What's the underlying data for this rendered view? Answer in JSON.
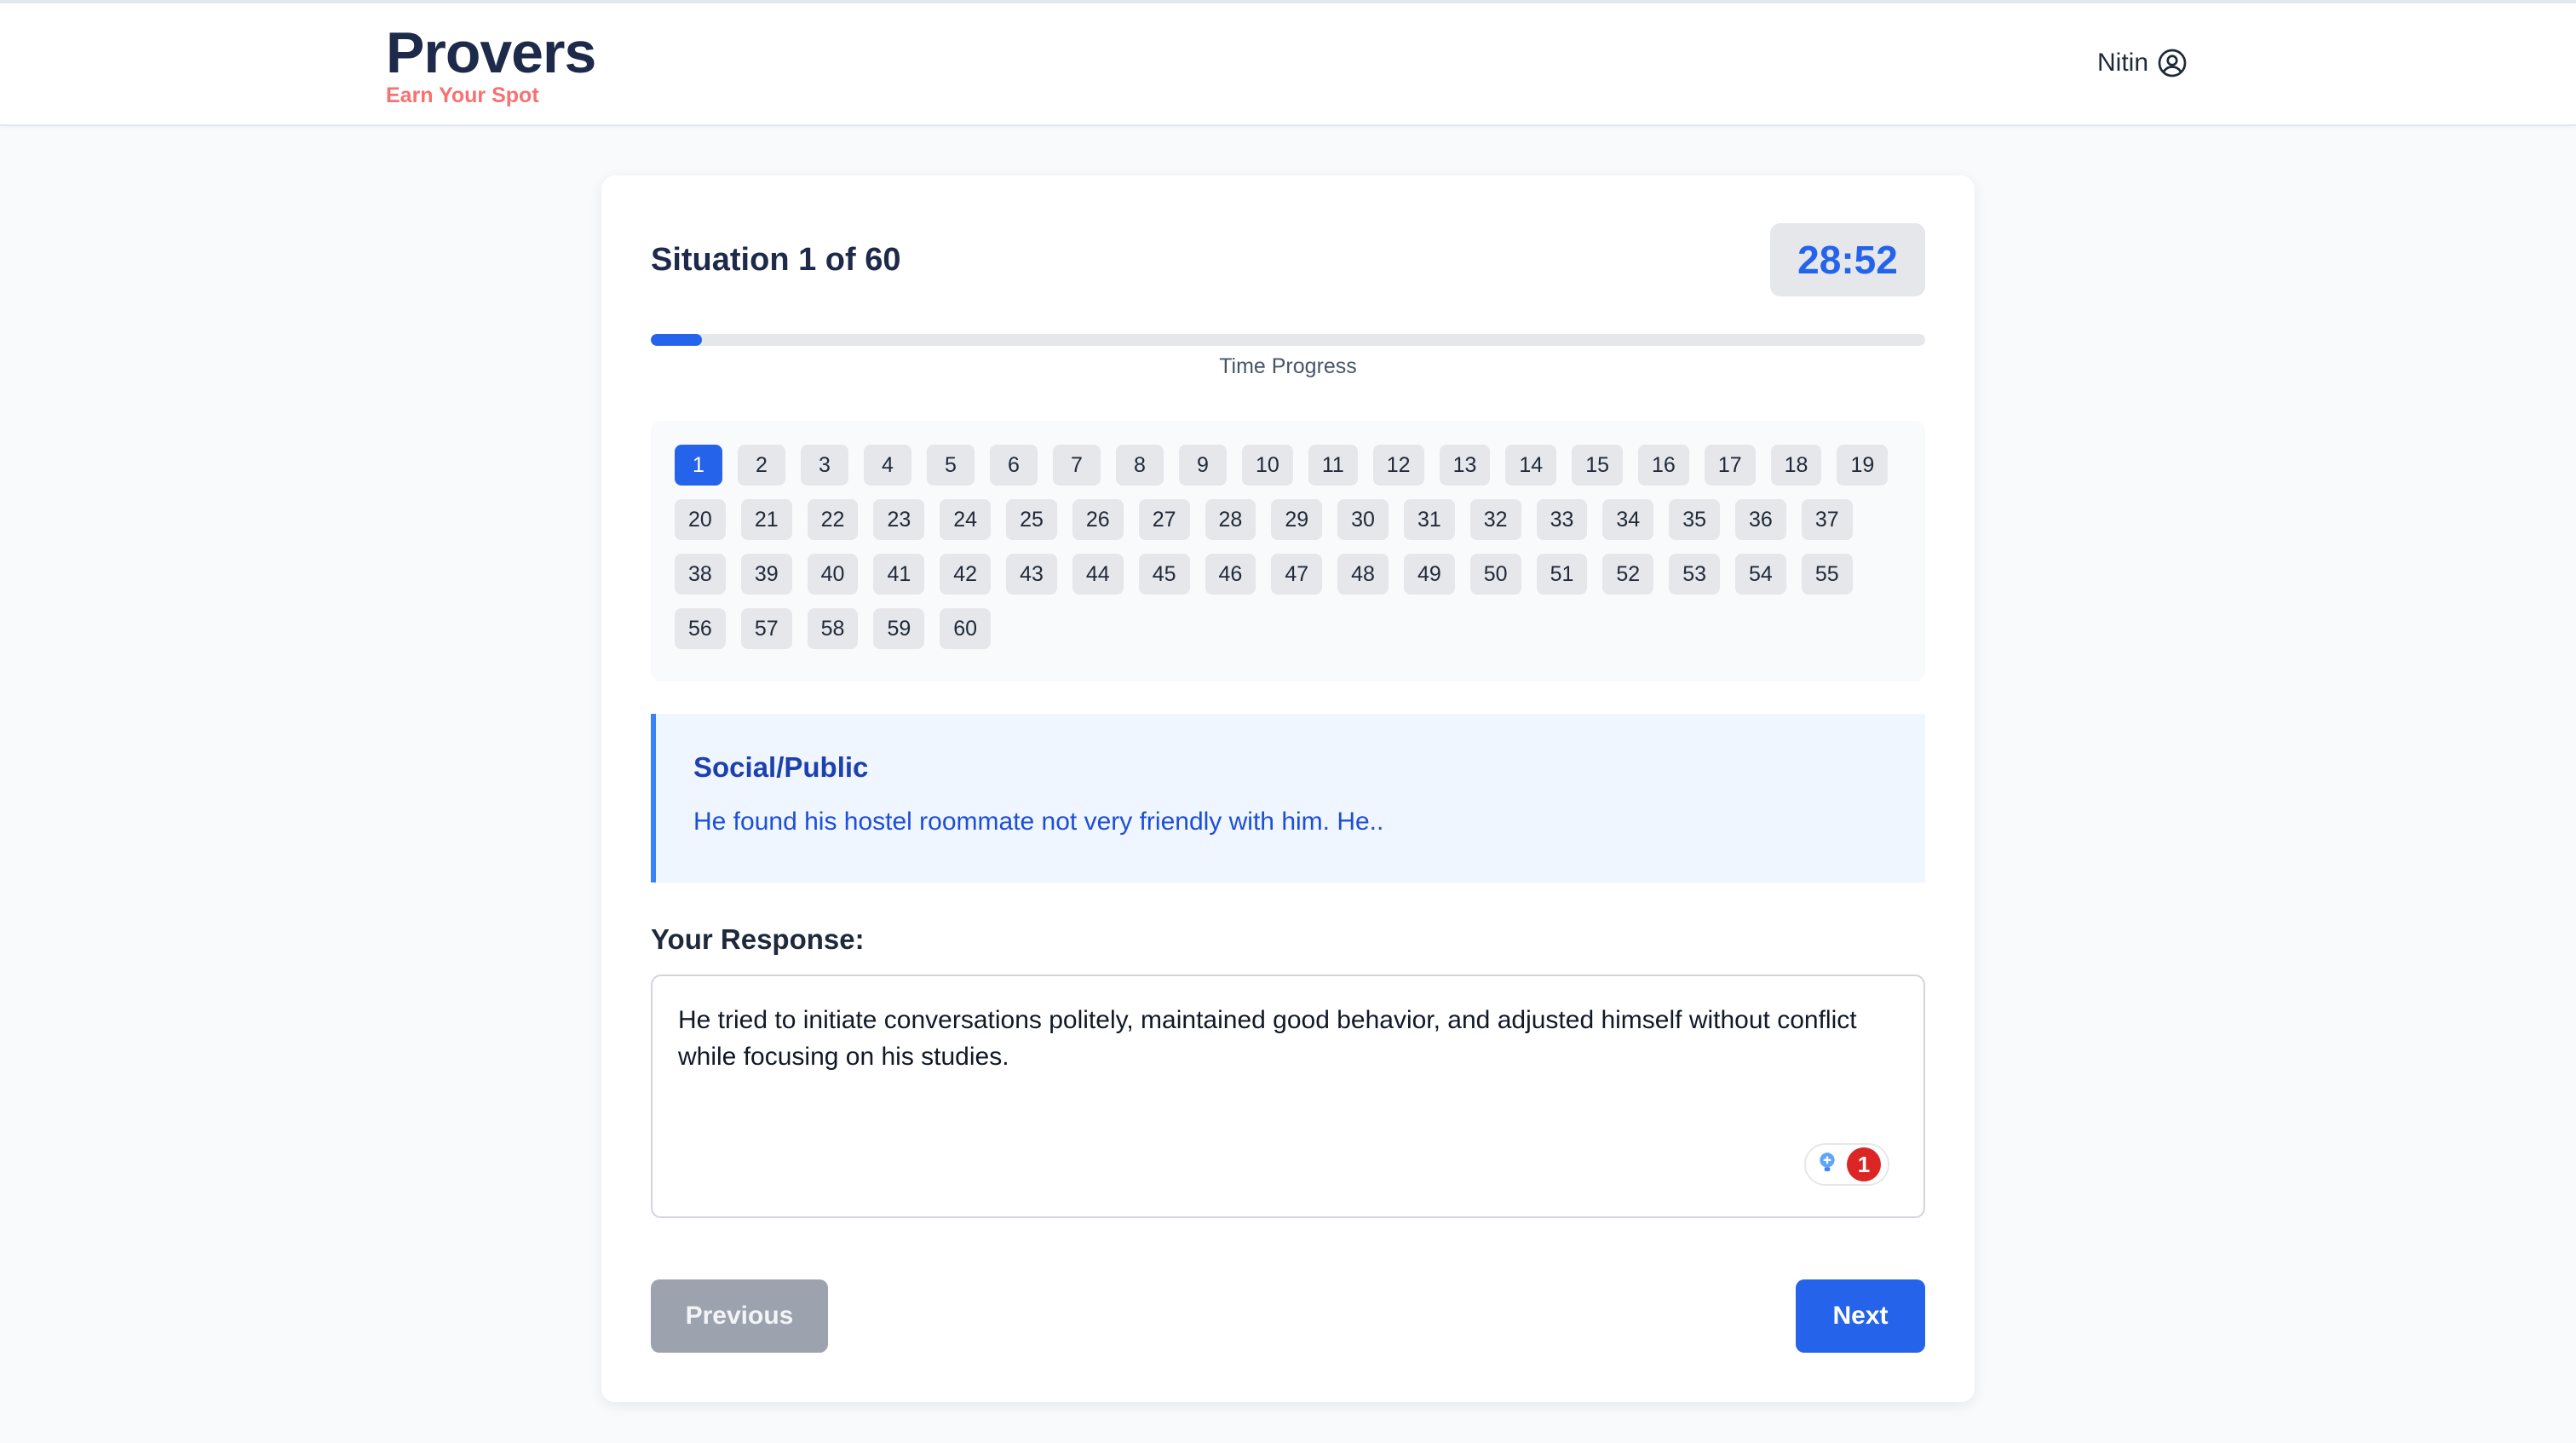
{
  "header": {
    "brand_name": "Provers",
    "brand_tagline": "Earn Your Spot",
    "user_name": "Nitin"
  },
  "quiz": {
    "title": "Situation 1 of 60",
    "timer": "28:52",
    "progress_label": "Time Progress",
    "progress_fraction": 0.04,
    "current_question": 1,
    "questions": [
      "1",
      "2",
      "3",
      "4",
      "5",
      "6",
      "7",
      "8",
      "9",
      "10",
      "11",
      "12",
      "13",
      "14",
      "15",
      "16",
      "17",
      "18",
      "19",
      "20",
      "21",
      "22",
      "23",
      "24",
      "25",
      "26",
      "27",
      "28",
      "29",
      "30",
      "31",
      "32",
      "33",
      "34",
      "35",
      "36",
      "37",
      "38",
      "39",
      "40",
      "41",
      "42",
      "43",
      "44",
      "45",
      "46",
      "47",
      "48",
      "49",
      "50",
      "51",
      "52",
      "53",
      "54",
      "55",
      "56",
      "57",
      "58",
      "59",
      "60"
    ]
  },
  "situation": {
    "category": "Social/Public",
    "text": "He found his hostel roommate not very friendly with him. He.."
  },
  "response": {
    "label": "Your Response:",
    "value": "He tried to initiate conversations politely, maintained good behavior, and adjusted himself without conflict while focusing on his studies.",
    "grammar_badge_count": "1"
  },
  "nav": {
    "previous_label": "Previous",
    "next_label": "Next"
  },
  "colors": {
    "primary": "#2563eb",
    "brand_dark": "#1e2a4a",
    "tagline": "#f87171",
    "disabled": "#9ca3af"
  },
  "icons": {
    "user": "user-circle-icon",
    "grammar": "grammarly-icon"
  }
}
